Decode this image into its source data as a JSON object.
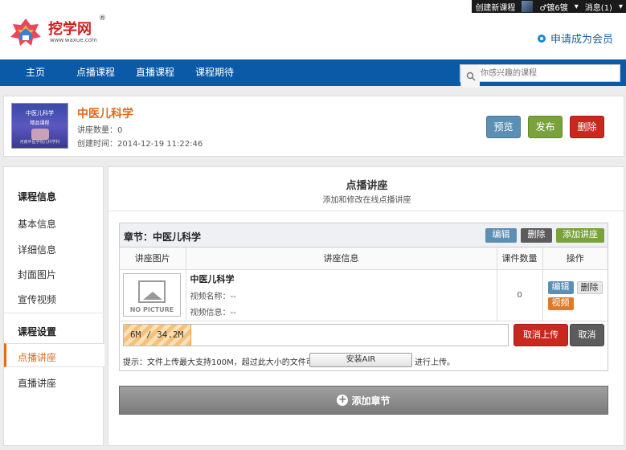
{
  "topbar": {
    "create_course": "创建新课程",
    "user": "♂镀6镀",
    "messages": "消息(1)"
  },
  "header": {
    "logo_text": "挖学网",
    "logo_reg": "®",
    "logo_url": "www.waxue.com",
    "apply_member": "申请成为会员"
  },
  "nav": {
    "items": [
      "主页",
      "点播课程",
      "直播课程",
      "课程期待"
    ],
    "search_placeholder": "搜索你感兴趣的课程"
  },
  "course": {
    "thumb_lines": [
      "中医儿科学",
      "精品课程",
      "河南中医学院儿科学科"
    ],
    "title": "中医儿科学",
    "count_label": "讲座数量：0",
    "created_label": "创建时间：2014-12-19 11:22:46",
    "preview_btn": "预览",
    "publish_btn": "发布",
    "delete_btn": "删除"
  },
  "sidebar": {
    "section1": "课程信息",
    "items1": [
      "基本信息",
      "详细信息",
      "封面图片",
      "宣传视频"
    ],
    "section2": "课程设置",
    "items2": [
      "点播讲座",
      "直播讲座"
    ]
  },
  "main": {
    "title": "点播讲座",
    "subtitle": "添加和修改在线点播讲座"
  },
  "chapter": {
    "title": "章节：中医儿科学",
    "edit_btn": "编辑",
    "delete_btn": "删除",
    "add_lecture_btn": "添加讲座",
    "columns": [
      "讲座图片",
      "讲座信息",
      "课件数量",
      "操作"
    ],
    "row": {
      "nopic": "NO PICTURE",
      "name": "中医儿科学",
      "video_name": "视频名称：--",
      "video_info": "视频信息：--",
      "count": "0",
      "edit_btn": "编辑",
      "delete_btn": "删除",
      "video_btn": "视频"
    },
    "upload": {
      "progress_text": "6M / 34.2M",
      "progress_fraction": 0.1754,
      "cancel_upload_btn": "取消上传",
      "cancel_btn": "取消"
    },
    "tip_prefix": "提示：文件上传最大支持100M，超过此大小的文件可",
    "air_btn": "安装AIR",
    "tip_suffix": "进行上传。"
  },
  "add_chapter_btn": "添加章节",
  "colors": {
    "nav_blue": "#0b5aa8",
    "accent_orange": "#e06a1a",
    "btn_blue": "#5b8fb4",
    "btn_green": "#7aa23a",
    "btn_red": "#c8281e"
  }
}
